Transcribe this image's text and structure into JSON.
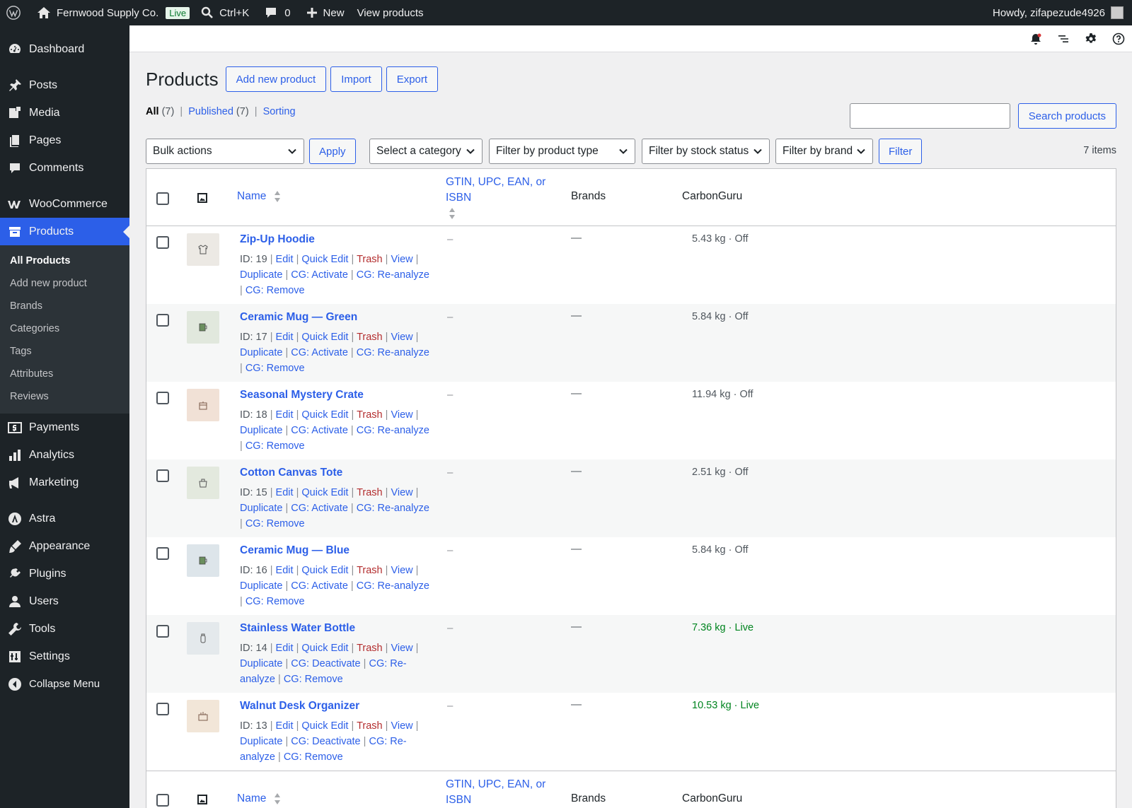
{
  "adminbar": {
    "site_name": "Fernwood Supply Co.",
    "live_label": "Live",
    "search_shortcut": "Ctrl+K",
    "comments_count": "0",
    "new_label": "New",
    "view_products_label": "View products",
    "howdy": "Howdy, zifapezude4926"
  },
  "sidebar": {
    "dashboard": "Dashboard",
    "posts": "Posts",
    "media": "Media",
    "pages": "Pages",
    "comments": "Comments",
    "woocommerce": "WooCommerce",
    "products": "Products",
    "submenu": [
      "All Products",
      "Add new product",
      "Brands",
      "Categories",
      "Tags",
      "Attributes",
      "Reviews"
    ],
    "payments": "Payments",
    "analytics": "Analytics",
    "marketing": "Marketing",
    "astra": "Astra",
    "appearance": "Appearance",
    "plugins": "Plugins",
    "users": "Users",
    "tools": "Tools",
    "settings": "Settings",
    "collapse": "Collapse Menu"
  },
  "header": {
    "title": "Products",
    "add_new": "Add new product",
    "import": "Import",
    "export": "Export"
  },
  "views": {
    "all_label": "All",
    "all_count": "(7)",
    "published_label": "Published",
    "published_count": "(7)",
    "sorting_label": "Sorting"
  },
  "search": {
    "value": "",
    "button": "Search products"
  },
  "filters": {
    "bulk_actions": "Bulk actions",
    "apply": "Apply",
    "category": "Select a category",
    "product_type": "Filter by product type",
    "stock_status": "Filter by stock status",
    "brand": "Filter by brand",
    "filter_button": "Filter",
    "items_count": "7 items"
  },
  "table": {
    "columns": {
      "name": "Name",
      "gtin_line1": "GTIN, UPC, EAN, or",
      "gtin_line2": "ISBN",
      "brands": "Brands",
      "carbon": "CarbonGuru"
    },
    "sep": "|",
    "action_labels": {
      "edit": "Edit",
      "quick_edit": "Quick Edit",
      "trash": "Trash",
      "view": "View",
      "duplicate": "Duplicate",
      "activate": "CG: Activate",
      "deactivate": "CG: Deactivate",
      "reanalyze": "CG: Re-analyze",
      "reanalyze_a": "CG: Re-",
      "reanalyze_b": "analyze",
      "remove": "CG: Remove"
    },
    "gtin_empty": "–",
    "brand_empty": "—",
    "rows": [
      {
        "name": "Zip-Up Hoodie",
        "id": "ID: 19",
        "carbon": "5.43 kg · Off",
        "live": false,
        "thumb_color": "#ece9e4",
        "icon": "hoodie-icon"
      },
      {
        "name": "Ceramic Mug — Green",
        "id": "ID: 17",
        "carbon": "5.84 kg · Off",
        "live": false,
        "thumb_color": "#e1e8dd",
        "icon": "mug-icon"
      },
      {
        "name": "Seasonal Mystery Crate",
        "id": "ID: 18",
        "carbon": "11.94 kg · Off",
        "live": false,
        "thumb_color": "#f1e1d6",
        "icon": "crate-icon"
      },
      {
        "name": "Cotton Canvas Tote",
        "id": "ID: 15",
        "carbon": "2.51 kg · Off",
        "live": false,
        "thumb_color": "#e3e9de",
        "icon": "tote-icon"
      },
      {
        "name": "Ceramic Mug — Blue",
        "id": "ID: 16",
        "carbon": "5.84 kg · Off",
        "live": false,
        "thumb_color": "#dde5ea",
        "icon": "mug-icon"
      },
      {
        "name": "Stainless Water Bottle",
        "id": "ID: 14",
        "carbon": "7.36 kg · Live",
        "live": true,
        "thumb_color": "#e4e9ec",
        "icon": "bottle-icon"
      },
      {
        "name": "Walnut Desk Organizer",
        "id": "ID: 13",
        "carbon": "10.53 kg · Live",
        "live": true,
        "thumb_color": "#f2e6d8",
        "icon": "organizer-icon"
      }
    ]
  }
}
